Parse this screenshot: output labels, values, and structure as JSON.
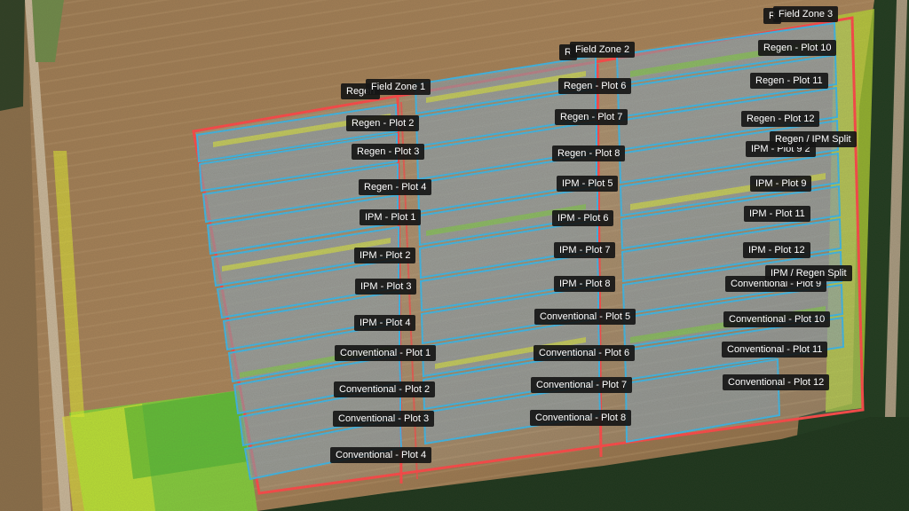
{
  "map": {
    "labels": {
      "zone1": "Field Zone 1",
      "zone2": "Field Zone 2",
      "zone3": "Field Zone 3",
      "r_zone1": "Regen",
      "r_zone2": "R",
      "r_zone3": "R",
      "regen2": "Regen - Plot 2",
      "regen3": "Regen - Plot 3",
      "regen4": "Regen - Plot 4",
      "ipm1": "IPM - Plot 1",
      "ipm2": "IPM - Plot 2",
      "ipm3": "IPM - Plot 3",
      "ipm4": "IPM - Plot 4",
      "conv1": "Conventional - Plot 1",
      "conv2": "Conventional - Plot  2",
      "conv3": "Conventional - Plot  3",
      "conv4": "Conventional - Plot  4",
      "regen6": "Regen - Plot 6",
      "regen7": "Regen - Plot 7",
      "regen8": "Regen - Plot 8",
      "ipm5": "IPM - Plot 5",
      "ipm6": "IPM - Plot 6",
      "ipm7": "IPM - Plot 7",
      "ipm8": "IPM - Plot 8",
      "conv5": "Conventional - Plot 5",
      "conv6": "Conventional - Plot  6",
      "conv7": "Conventional - Plot  7",
      "conv8": "Conventional - Plot  8",
      "regen10": "Regen - Plot 10",
      "regen11": "Regen - Plot 11",
      "regen12": "Regen - Plot 12",
      "regen_split": "Regen / IPM Split",
      "ipm9_2": "IPM - Plot 9 2",
      "ipm9": "IPM - Plot 9",
      "ipm11": "IPM - Plot 11",
      "ipm12": "IPM - Plot 12",
      "ipm_split": "IPM / Regen Split",
      "conv9": "Conventional - Plot 9",
      "conv10": "Conventional - Plot  10",
      "conv11": "Conventional - Plot  11",
      "conv12": "Conventional - Plot  12"
    },
    "colors": {
      "field_boundary": "#ff4a4a",
      "plot_outline": "#3fb8e8",
      "plot_fill": "#8ea3b0",
      "label_bg": "#161616",
      "label_text": "#ffffff",
      "vegetation_high": "#2ecc40",
      "vegetation_mid": "#e6f032",
      "vegetation_low": "#e84a2c"
    }
  }
}
